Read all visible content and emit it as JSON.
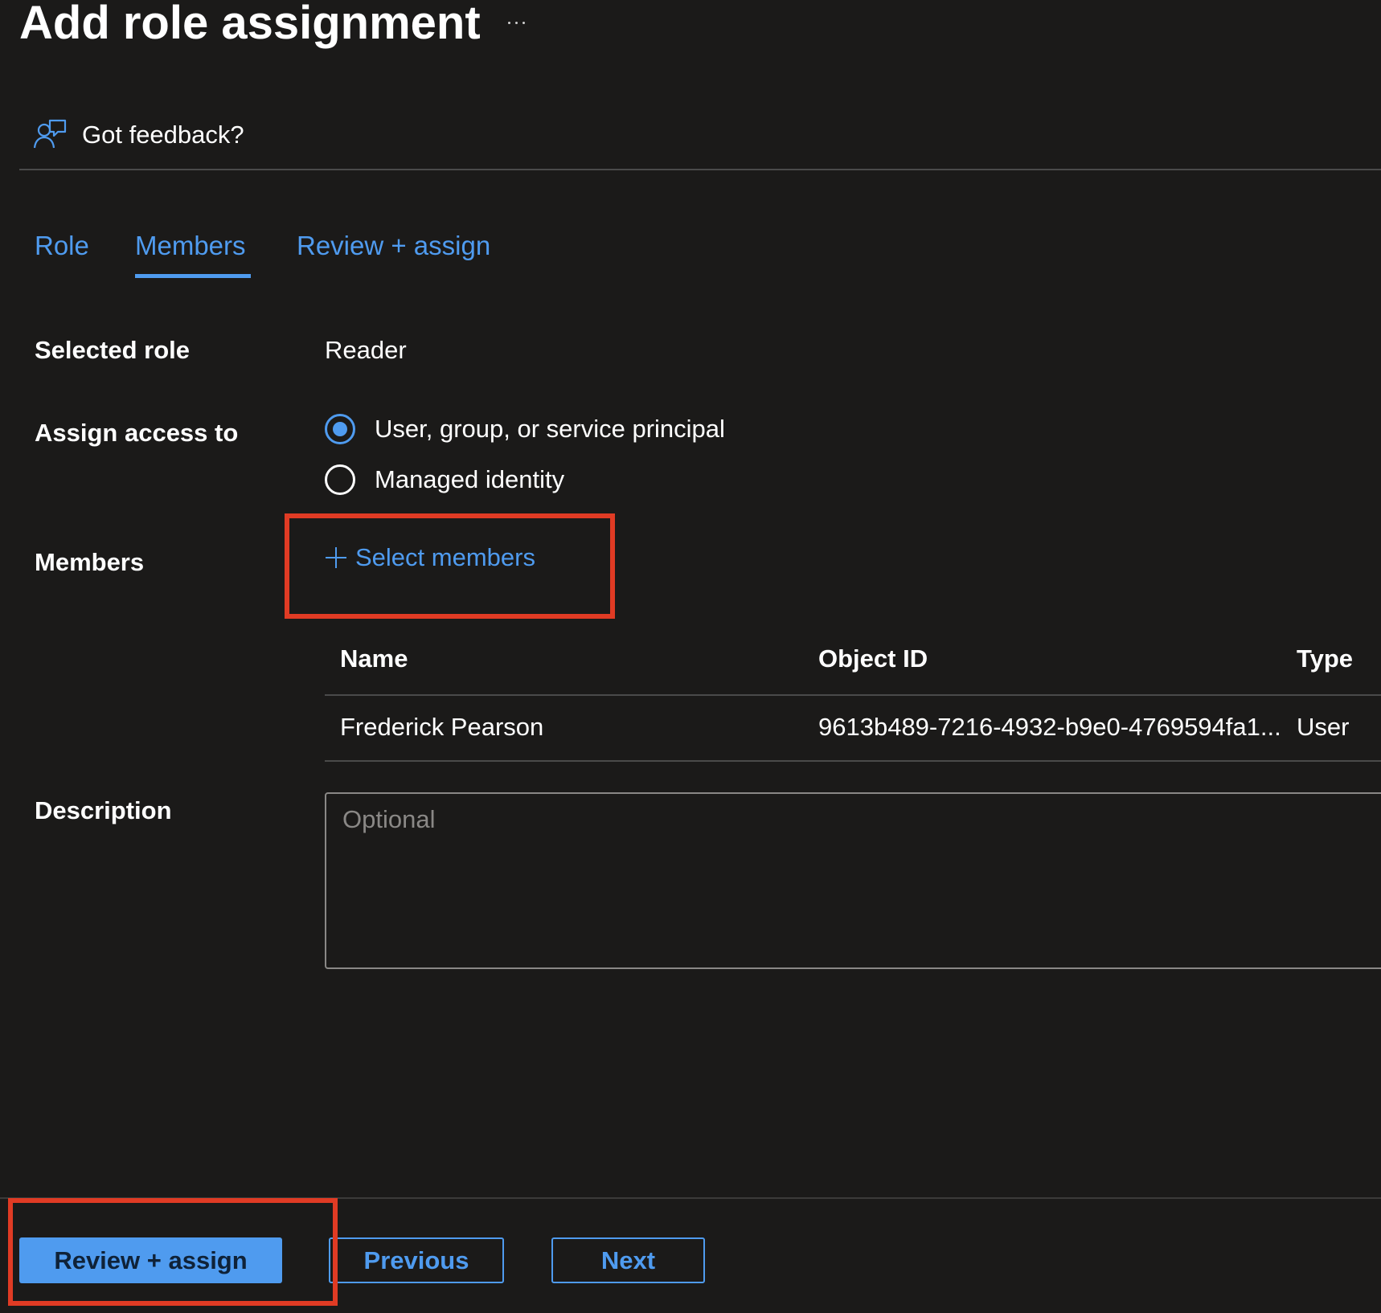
{
  "header": {
    "title": "Add role assignment",
    "more_icon": "more-horizontal-icon"
  },
  "feedback": {
    "label": "Got feedback?",
    "icon": "feedback-person-icon"
  },
  "tabs": [
    {
      "label": "Role",
      "active": false
    },
    {
      "label": "Members",
      "active": true
    },
    {
      "label": "Review + assign",
      "active": false
    }
  ],
  "form": {
    "selected_role_label": "Selected role",
    "selected_role_value": "Reader",
    "assign_access_label": "Assign access to",
    "assign_options": [
      {
        "label": "User, group, or service principal",
        "checked": true
      },
      {
        "label": "Managed identity",
        "checked": false
      }
    ],
    "members_label": "Members",
    "select_members_label": "Select members",
    "description_label": "Description",
    "description_placeholder": "Optional"
  },
  "members_table": {
    "columns": [
      "Name",
      "Object ID",
      "Type"
    ],
    "rows": [
      [
        "Frederick Pearson",
        "9613b489-7216-4932-b9e0-4769594fa1...",
        "User"
      ]
    ]
  },
  "footer": {
    "review_assign_label": "Review + assign",
    "previous_label": "Previous",
    "next_label": "Next"
  },
  "colors": {
    "background": "#1b1a19",
    "accent": "#4f9bef",
    "highlight": "#e03b24"
  }
}
